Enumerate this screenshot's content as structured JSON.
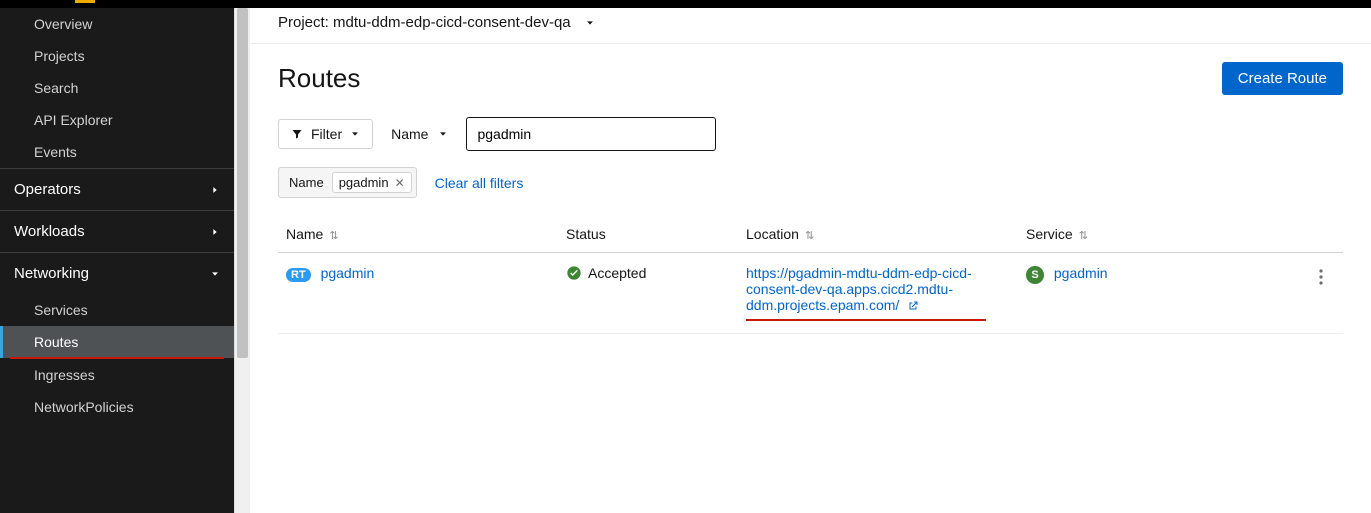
{
  "sidebar": {
    "home": [
      "Overview",
      "Projects",
      "Search",
      "API Explorer",
      "Events"
    ],
    "groups": {
      "operators": "Operators",
      "workloads": "Workloads",
      "networking": "Networking"
    },
    "networking_items": [
      "Services",
      "Routes",
      "Ingresses",
      "NetworkPolicies"
    ]
  },
  "projectbar": {
    "label": "Project:",
    "value": "mdtu-ddm-edp-cicd-consent-dev-qa"
  },
  "page": {
    "heading": "Routes",
    "create_button": "Create Route"
  },
  "filters": {
    "filter_label": "Filter",
    "attr_label": "Name",
    "search_value": "pgadmin",
    "chip_group_label": "Name",
    "chip_value": "pgadmin",
    "clear": "Clear all filters"
  },
  "table": {
    "headers": {
      "name": "Name",
      "status": "Status",
      "location": "Location",
      "service": "Service"
    },
    "row": {
      "badge": "RT",
      "name": "pgadmin",
      "status": "Accepted",
      "location": "https://pgadmin-mdtu-ddm-edp-cicd-consent-dev-qa.apps.cicd2.mdtu-ddm.projects.epam.com/",
      "service_badge": "S",
      "service": "pgadmin"
    }
  }
}
